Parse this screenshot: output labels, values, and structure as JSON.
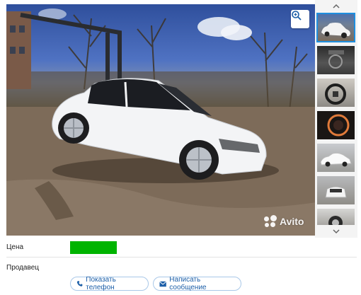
{
  "gallery": {
    "zoom_icon": "zoom-in-icon",
    "watermark_text": "Avito",
    "thumbnails": [
      {
        "subject": "white sedan exterior",
        "active": true
      },
      {
        "subject": "dashboard interior"
      },
      {
        "subject": "steering wheel"
      },
      {
        "subject": "instrument cluster"
      },
      {
        "subject": "sedan side view"
      },
      {
        "subject": "rear view"
      },
      {
        "subject": "wheel"
      }
    ]
  },
  "listing": {
    "price_label": "Цена",
    "seller_label": "Продавец",
    "show_phone_label": "Показать телефон",
    "write_message_label": "Написать сообщение"
  },
  "colors": {
    "accent": "#1d5fa8",
    "price_bar": "#00b400"
  }
}
